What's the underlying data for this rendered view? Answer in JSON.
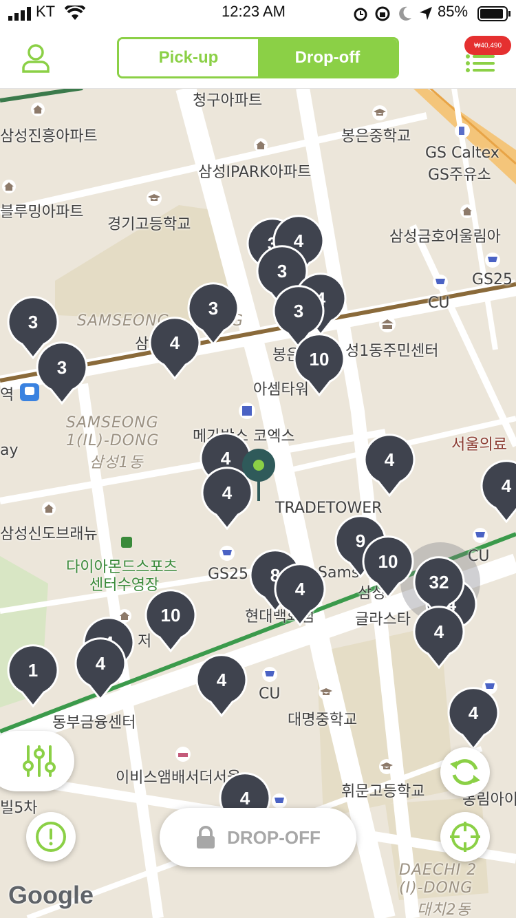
{
  "status_bar": {
    "carrier": "KT",
    "time": "12:23 AM",
    "battery": "85%"
  },
  "header": {
    "tabs": [
      "Pick-up",
      "Drop-off"
    ],
    "active_tab": "Drop-off",
    "badge": "₩40,490"
  },
  "map": {
    "labels": [
      "청구아파트",
      "삼성진흥아파트",
      "봉은중학교",
      "GS Caltex",
      "GS주유소",
      "삼성IPARK아파트",
      "블루밍아파트",
      "경기고등학교",
      "삼성금호어울림아",
      "GS25",
      "CU",
      "SAMSEONG",
      "G",
      "삼",
      "봉은",
      "성1동주민센터",
      "아셈타워",
      "역",
      "SAMSEONG",
      "1(IL)-DONG",
      "삼성1동",
      "메가박스 코엑스",
      "서울의료",
      "ay",
      "TRADETOWER",
      "삼성신도브래뉴",
      "다이아몬드스포츠",
      "센터수영장",
      "GS25",
      "현대백화점",
      "Sams",
      "삼성",
      "글라스타",
      "저",
      "CU",
      "CU",
      "동부금융센터",
      "대명중학교",
      "이비스앰배서더서울",
      "휘문고등학교",
      "빌5차",
      "동림아이",
      "DAECHI 2",
      "(I)-DONG",
      "대치2동"
    ],
    "pins": [
      "3",
      "4",
      "3",
      "4",
      "3",
      "3",
      "4",
      "3",
      "10",
      "4",
      "4",
      "4",
      "9",
      "10",
      "8",
      "4",
      "32",
      "4",
      "4",
      "10",
      "4",
      "4",
      "1",
      "4",
      "4",
      "4",
      "4"
    ]
  },
  "buttons": {
    "dropoff": "DROP-OFF"
  },
  "attribution": "Google"
}
